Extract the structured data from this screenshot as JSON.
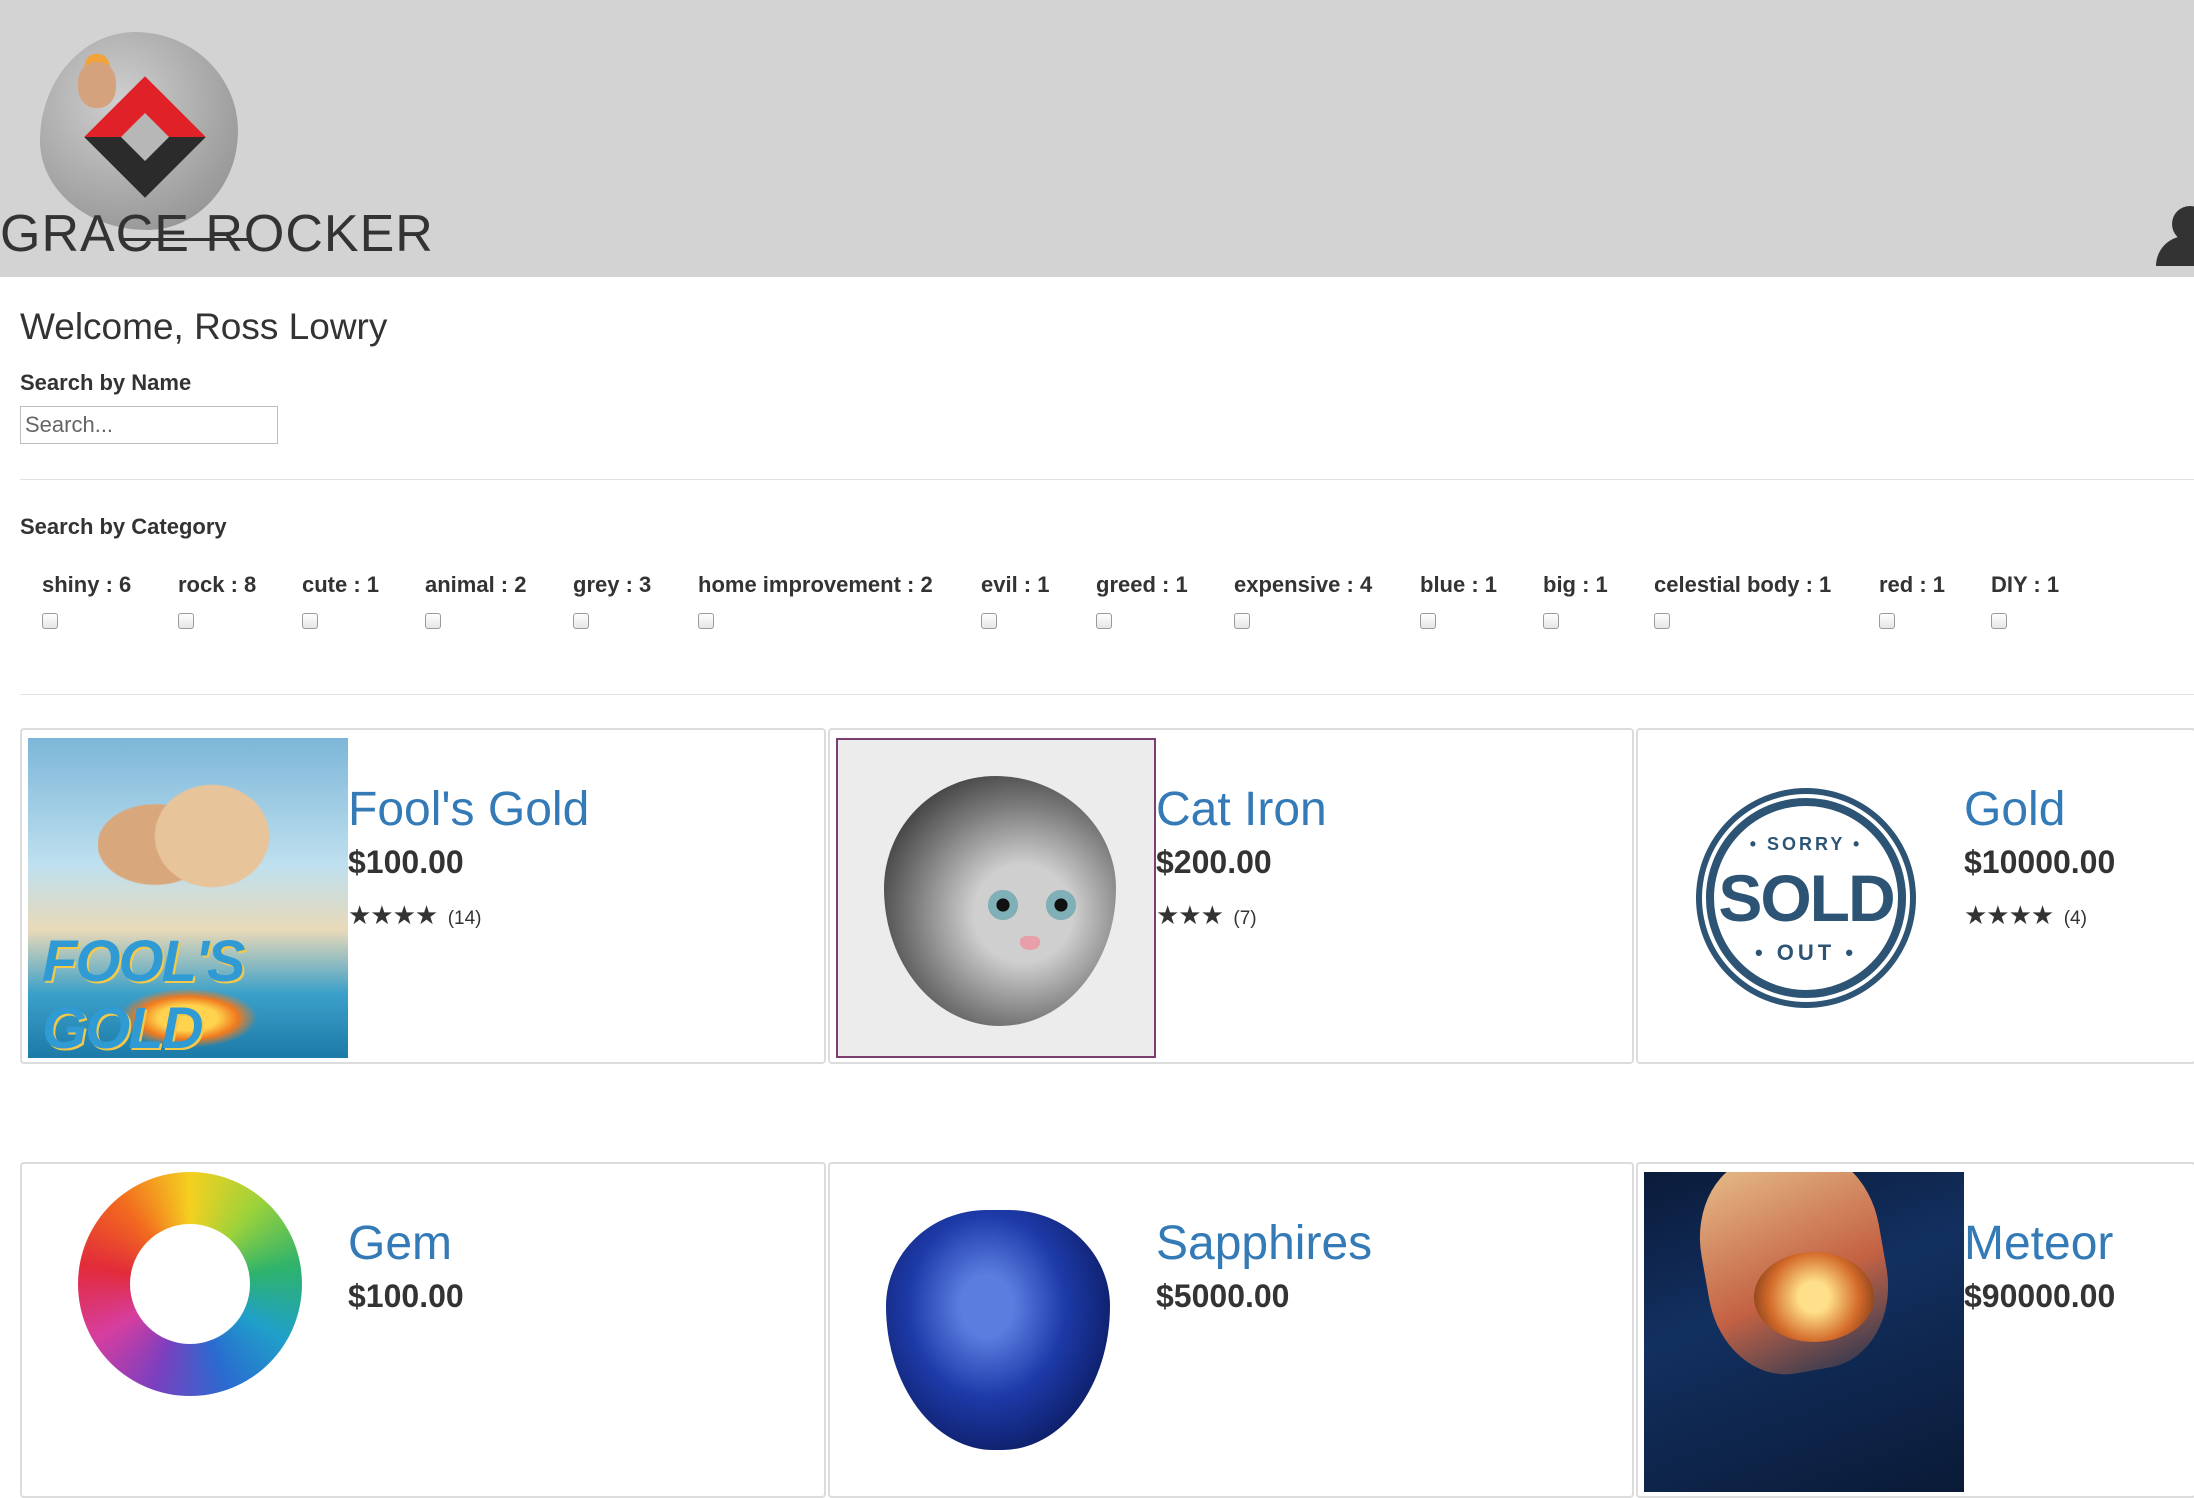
{
  "header": {
    "brand": "GRACE ROCKER",
    "user_icon": "user-icon"
  },
  "welcome": "Welcome, Ross Lowry",
  "search_name": {
    "label": "Search by Name",
    "placeholder": "Search...",
    "value": ""
  },
  "search_category": {
    "label": "Search by Category",
    "categories": [
      {
        "label": "shiny : 6",
        "checked": false
      },
      {
        "label": "rock : 8",
        "checked": false
      },
      {
        "label": "cute : 1",
        "checked": false
      },
      {
        "label": "animal : 2",
        "checked": false
      },
      {
        "label": "grey : 3",
        "checked": false
      },
      {
        "label": "home improvement : 2",
        "checked": false
      },
      {
        "label": "evil : 1",
        "checked": false
      },
      {
        "label": "greed : 1",
        "checked": false
      },
      {
        "label": "expensive : 4",
        "checked": false
      },
      {
        "label": "blue : 1",
        "checked": false
      },
      {
        "label": "big : 1",
        "checked": false
      },
      {
        "label": "celestial body : 1",
        "checked": false
      },
      {
        "label": "red : 1",
        "checked": false
      },
      {
        "label": "DIY : 1",
        "checked": false
      }
    ]
  },
  "products": [
    {
      "name": "Fool's Gold",
      "price": "$100.00",
      "stars": "★★★★",
      "reviews": "(14)",
      "image": "fools-gold-movie-poster",
      "image_text": "FOOL'S GOLD"
    },
    {
      "name": "Cat Iron",
      "price": "$200.00",
      "stars": "★★★",
      "reviews": "(7)",
      "image": "painted-cat-rock"
    },
    {
      "name": "Gold",
      "price": "$10000.00",
      "stars": "★★★★",
      "reviews": "(4)",
      "image": "sold-out-badge",
      "badge": {
        "top": "• SORRY •",
        "main": "SOLD",
        "bottom": "• OUT •"
      }
    },
    {
      "name": "Gem",
      "price": "$100.00",
      "image": "rainbow-gem"
    },
    {
      "name": "Sapphires",
      "price": "$5000.00",
      "image": "blue-sapphire"
    },
    {
      "name": "Meteor",
      "price": "$90000.00",
      "image": "meteor"
    }
  ],
  "colors": {
    "header_bg": "#d3d3d3",
    "link": "#337ab7",
    "text": "#333333",
    "sold_badge": "#2d5475"
  }
}
